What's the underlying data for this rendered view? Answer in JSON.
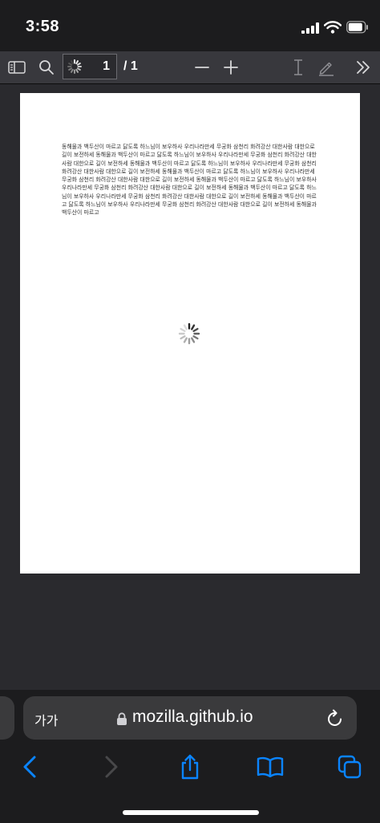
{
  "status_bar": {
    "time": "3:58"
  },
  "pdf_toolbar": {
    "page_number": "1",
    "page_count": "/ 1"
  },
  "document": {
    "text": "동해물과 백두산이 마르고 닳도록 하느님이 보우하사 우리나라만세 무궁화 삼천리 화려강산 대한사람 대한으로 길이 보전하세 동해물과 백두산이 마르고 닳도록 하느님이 보우하사 우리나라만세 무궁화 삼천리 화려강산 대한사람 대한으로 길이 보전하세 동해물과 백두산이 마르고 닳도록 하느님이 보우하사 우리나라만세 무궁화 삼천리 화려강산 대한사람 대한으로 길이 보전하세 동해물과 백두산이 마르고 닳도록 하느님이 보우하사 우리나라만세 무궁화 삼천리 화려강산 대한사람 대한으로 길이 보전하세 동해물과 백두산이 마르고 닳도록 하느님이 보우하사 우리나라만세 무궁화 삼천리 화려강산 대한사람 대한으로 길이 보전하세 동해물과 백두산이 마르고 닳도록 하느님이 보우하사 우리나라만세 무궁화 삼천리 화려강산 대한사람 대한으로 길이 보전하세 동해물과 백두산이 마르고 닳도록 하느님이 보우하사 우리나라만세 무궁화 삼천리 화려강산 대한사람 대한으로 길이 보전하세 동해물과 백두산이 마르고"
  },
  "browser": {
    "reader_label": "가가",
    "domain": "mozilla.github.io"
  },
  "colors": {
    "accent": "#0a84ff",
    "toolbar": "#38383d",
    "viewer_bg": "#2a2a2e"
  }
}
